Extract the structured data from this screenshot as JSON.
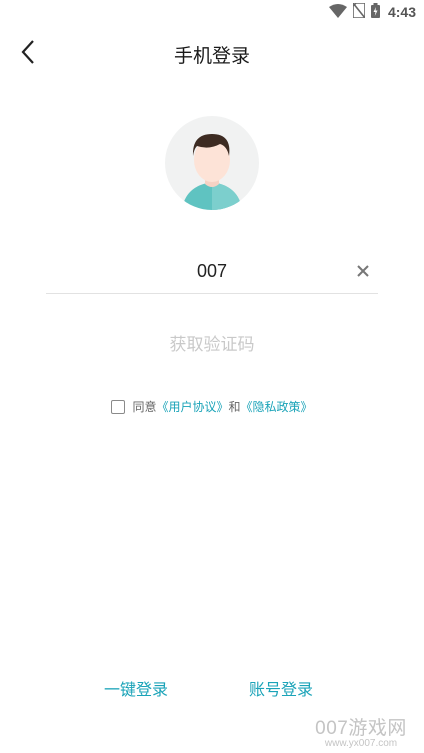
{
  "status_bar": {
    "time": "4:43",
    "icons": [
      "wifi-icon",
      "no-sim-icon",
      "battery-charging-icon"
    ]
  },
  "header": {
    "title": "手机登录",
    "back_icon": "chevron-left-icon"
  },
  "avatar": {
    "icon": "default-avatar-icon",
    "colors": {
      "background": "#f1f2f2",
      "hair": "#3d2b22",
      "skin": "#fde3d7",
      "shirt": "#5fc3c1"
    }
  },
  "phone_field": {
    "value": "007",
    "clear_icon": "close-icon"
  },
  "get_code": {
    "label": "获取验证码"
  },
  "agreement": {
    "prefix": "同意",
    "user_agreement": "《用户协议》",
    "conjunction": "和",
    "privacy_policy": "《隐私政策》",
    "checked": false
  },
  "bottom": {
    "one_key_login": "一键登录",
    "account_login": "账号登录"
  },
  "watermark": {
    "main": "007游戏网",
    "url": "www.yx007.com"
  },
  "colors": {
    "accent": "#1aa3b8",
    "disabled_text": "#c9c9c9",
    "divider": "#e2e2e2"
  }
}
